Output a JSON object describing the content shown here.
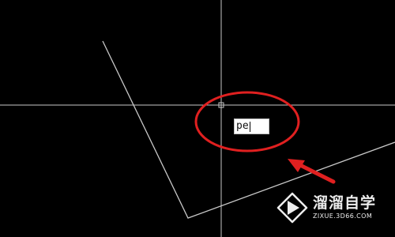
{
  "canvas": {
    "background_color": "#000000",
    "line_color": "#c8c8c8",
    "crosshair_color": "#c8c8c8"
  },
  "command_input": {
    "value": "pe"
  },
  "annotation": {
    "circle_color": "#e02020",
    "arrow_color": "#e02020"
  },
  "watermark": {
    "title": "溜溜自学",
    "url": "ZIXUE.3D66.COM",
    "logo_icon": "play-triangle-icon",
    "logo_color": "#ffffff"
  }
}
